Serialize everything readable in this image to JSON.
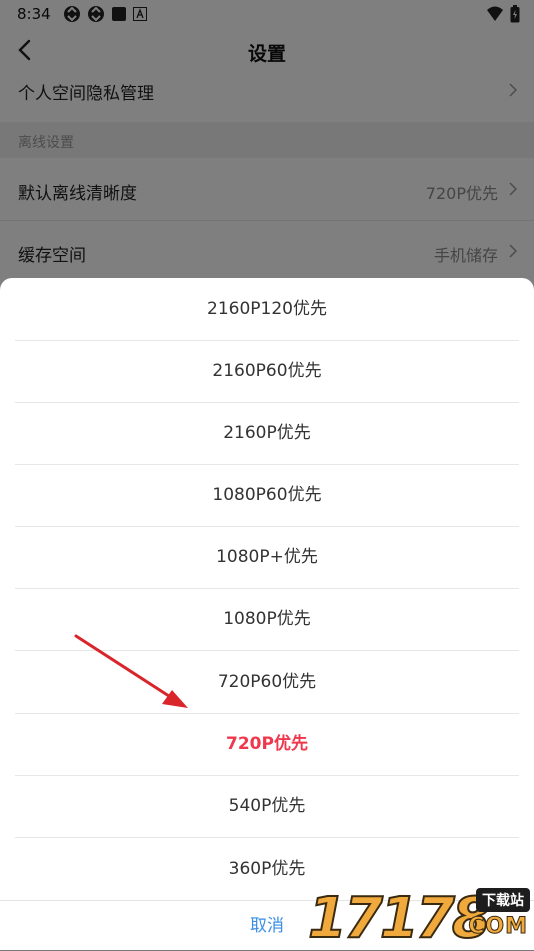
{
  "status_bar": {
    "time": "8:34",
    "icons": [
      "sync-icon",
      "sync-icon",
      "square-icon",
      "a-icon"
    ],
    "right_icons": [
      "wifi-icon",
      "battery-icon"
    ]
  },
  "nav": {
    "title": "设置"
  },
  "settings": {
    "privacy": {
      "label": "个人空间隐私管理"
    },
    "section_offline": "离线设置",
    "default_quality": {
      "label": "默认离线清晰度",
      "value": "720P优先"
    },
    "cache": {
      "label": "缓存空间",
      "value": "手机储存"
    }
  },
  "sheet": {
    "options": [
      "2160P120优先",
      "2160P60优先",
      "2160P优先",
      "1080P60优先",
      "1080P+优先",
      "1080P优先",
      "720P60优先",
      "720P优先",
      "540P优先",
      "360P优先"
    ],
    "selected_index": 7,
    "cancel": "取消"
  },
  "colors": {
    "selected": "#f0384d",
    "cancel": "#3a8ee6",
    "arrow": "#d8262b"
  },
  "watermark": {
    "digits": "17178",
    "tag": "下载站",
    "suffix": "COM"
  }
}
